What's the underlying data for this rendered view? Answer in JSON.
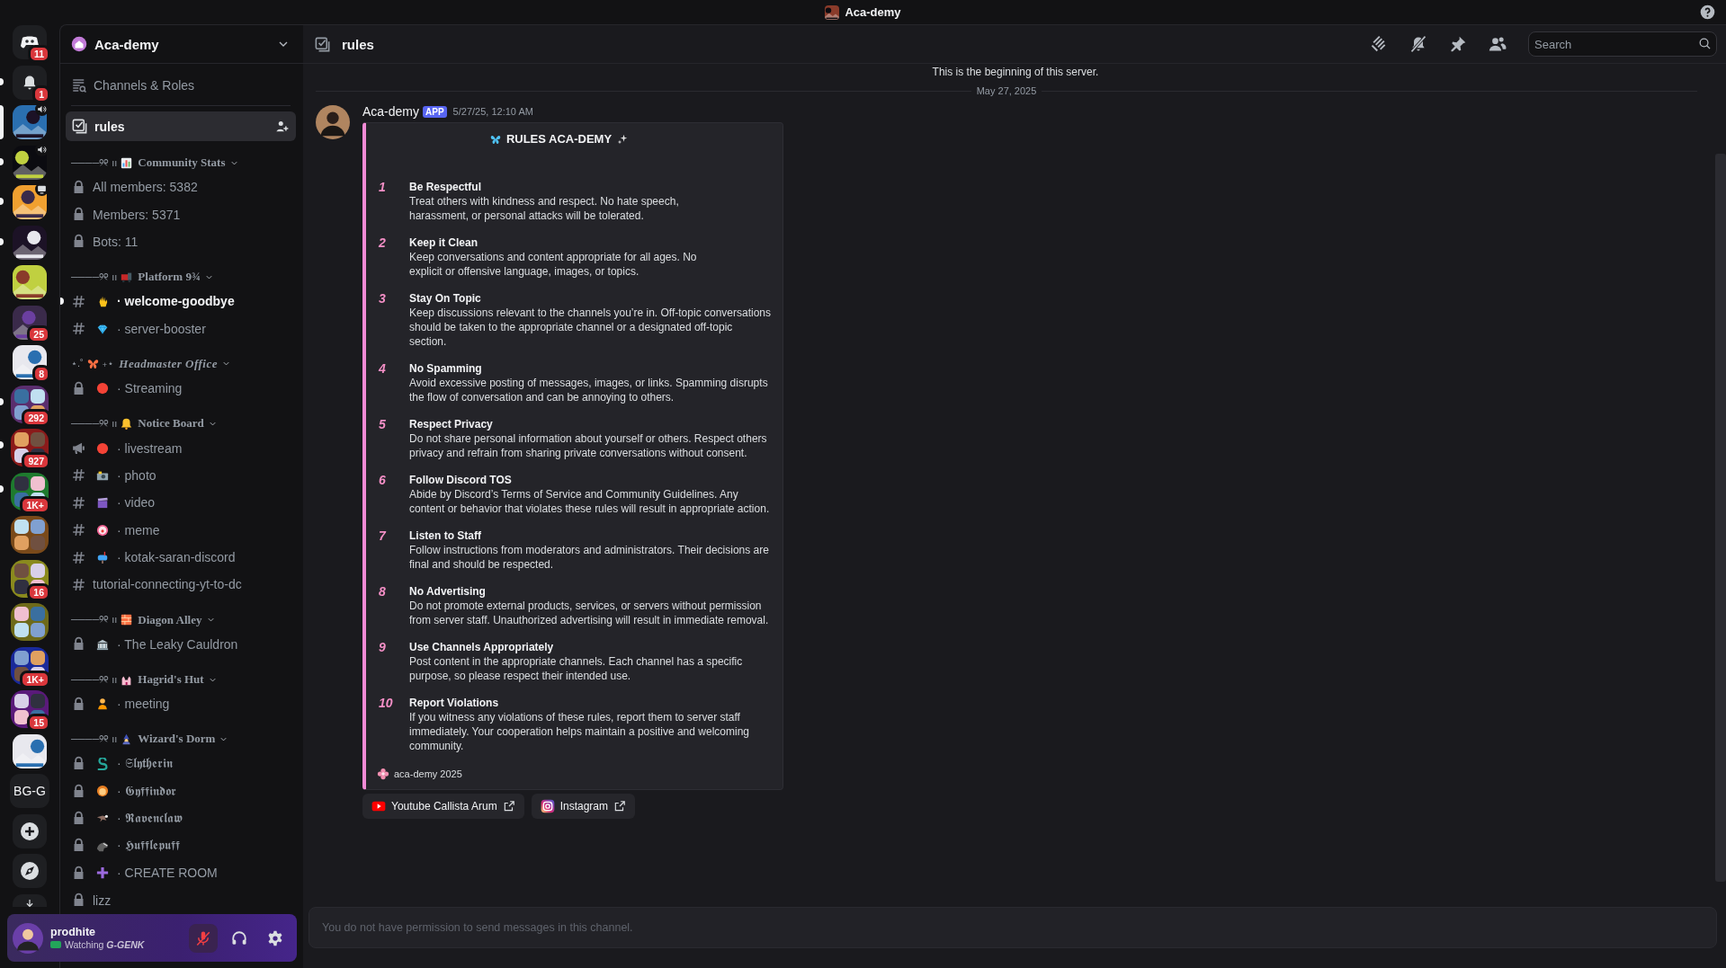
{
  "titlebar": {
    "title": "Aca-demy"
  },
  "servers": [
    {
      "kind": "home",
      "badge": "11",
      "selected": false,
      "unread": false
    },
    {
      "kind": "inbox",
      "badge": "1",
      "selected": false,
      "unread": true
    },
    {
      "kind": "picture",
      "selected": true,
      "unread": false
    },
    {
      "kind": "picture",
      "selected": false,
      "unread": true
    },
    {
      "kind": "picture",
      "selected": false,
      "unread": true
    },
    {
      "kind": "picture",
      "selected": false,
      "unread": true
    },
    {
      "kind": "picture",
      "selected": false,
      "unread": false
    },
    {
      "kind": "picture",
      "badge": "25",
      "selected": false,
      "unread": false
    },
    {
      "kind": "picture",
      "badge": "8",
      "selected": false,
      "unread": false
    },
    {
      "kind": "folder",
      "badge": "292",
      "selected": false,
      "unread": true
    },
    {
      "kind": "folder",
      "badge": "927",
      "selected": false,
      "unread": true
    },
    {
      "kind": "folder",
      "badge": "1K+",
      "selected": false,
      "unread": true
    },
    {
      "kind": "folder",
      "selected": false,
      "unread": false
    },
    {
      "kind": "folder",
      "badge": "16",
      "selected": false,
      "unread": false
    },
    {
      "kind": "folder",
      "selected": false,
      "unread": false
    },
    {
      "kind": "folder",
      "badge": "1K+",
      "selected": false,
      "unread": false
    },
    {
      "kind": "folder",
      "badge": "15",
      "selected": false,
      "unread": false
    },
    {
      "kind": "picture",
      "selected": false,
      "unread": false
    },
    {
      "kind": "text",
      "label": "BG-G",
      "selected": false,
      "unread": false
    },
    {
      "kind": "add",
      "selected": false,
      "unread": false
    },
    {
      "kind": "explore",
      "selected": false,
      "unread": false
    },
    {
      "kind": "download",
      "selected": false,
      "unread": false
    }
  ],
  "sidebar": {
    "server_name": "Aca-demy",
    "browse": "Channels & Roles",
    "top_channels": [
      {
        "kind": "rules",
        "name": "rules",
        "selected": true,
        "unread": false
      }
    ],
    "categories": [
      {
        "kind": "plain",
        "ornament": "────୨୧ ıı",
        "name": "Community Stats",
        "channels": [
          {
            "kind": "locked",
            "name": "All members: 5382",
            "selected": false,
            "unread": false
          },
          {
            "kind": "locked",
            "name": "Members: 5371",
            "selected": false,
            "unread": false
          },
          {
            "kind": "locked",
            "name": "Bots: 11",
            "selected": false,
            "unread": false
          }
        ]
      },
      {
        "kind": "plain",
        "ornament": "────୨୧ ıı",
        "name": "Platform 9¾",
        "channels": [
          {
            "kind": "text",
            "name": "· welcome-goodbye",
            "selected": false,
            "unread": true
          },
          {
            "kind": "text",
            "name": "· server-booster",
            "selected": false,
            "unread": false
          }
        ]
      },
      {
        "kind": "fancy",
        "ornament": "⋆.˚",
        "ornament_after": "₊⋆",
        "name": "Headmaster Office",
        "channels": [
          {
            "kind": "locked",
            "name": "·  Streaming",
            "selected": false,
            "unread": false
          }
        ]
      },
      {
        "kind": "plain",
        "ornament": "────୨୧ ıı",
        "name": "Notice Board",
        "channels": [
          {
            "kind": "announcement",
            "name": "· livestream",
            "selected": false,
            "unread": false
          },
          {
            "kind": "text",
            "name": "· photo",
            "selected": false,
            "unread": false
          },
          {
            "kind": "text",
            "name": "· video",
            "selected": false,
            "unread": false
          },
          {
            "kind": "text",
            "name": "· meme",
            "selected": false,
            "unread": false
          },
          {
            "kind": "text",
            "name": "· kotak-saran-discord",
            "selected": false,
            "unread": false
          },
          {
            "kind": "text",
            "name": "tutorial-connecting-yt-to-dc",
            "selected": false,
            "unread": false
          }
        ]
      },
      {
        "kind": "plain",
        "ornament": "────୨୧ ıı",
        "name": "Diagon Alley",
        "channels": [
          {
            "kind": "locked",
            "name": "· The Leaky Cauldron",
            "selected": false,
            "unread": false
          }
        ]
      },
      {
        "kind": "plain",
        "ornament": "────୨୧ ıı",
        "name": "Hagrid's Hut",
        "channels": [
          {
            "kind": "locked",
            "name": "· meeting",
            "selected": false,
            "unread": false
          }
        ]
      },
      {
        "kind": "plain",
        "ornament": "────୨୧ ıı",
        "name": "Wizard's Dorm",
        "channels": [
          {
            "kind": "locked",
            "name": "· 𝕾𝖑𝖞𝖙𝖍𝖊𝖗𝖎𝖓",
            "selected": false,
            "unread": false
          },
          {
            "kind": "locked",
            "name": "· 𝕲𝖞𝖋𝖋𝖎𝖓𝖉𝖔𝖗",
            "selected": false,
            "unread": false
          },
          {
            "kind": "locked",
            "name": "· 𝕽𝖆𝖛𝖊𝖓𝖈𝖑𝖆𝖜",
            "selected": false,
            "unread": false
          },
          {
            "kind": "locked",
            "name": "· 𝕳𝖚𝖋𝖋𝖑𝖊𝖕𝖚𝖋𝖋",
            "selected": false,
            "unread": false
          },
          {
            "kind": "locked",
            "name": "·  CREATE ROOM",
            "selected": false,
            "unread": false
          },
          {
            "kind": "locked",
            "name": "lizz",
            "selected": false,
            "unread": false
          }
        ]
      }
    ]
  },
  "channel_header": {
    "name": "rules",
    "search": {
      "placeholder": "Search"
    }
  },
  "chat": {
    "intro": "This is the beginning of this server.",
    "date_divider": "May 27, 2025",
    "message": {
      "author": "Aca-demy",
      "tag": "APP",
      "time": "5/27/25, 12:10 AM",
      "embed": {
        "title": "RULES ACA-DEMY",
        "rules": [
          {
            "number": "1",
            "title": "Be Respectful",
            "text": "Treat others with kindness and respect. No hate speech,\nharassment, or personal attacks will be tolerated."
          },
          {
            "number": "2",
            "title": "Keep it Clean",
            "text": "Keep conversations and content appropriate for all ages. No\nexplicit or offensive language, images, or topics."
          },
          {
            "number": "3",
            "title": "Stay On Topic",
            "text": "Keep discussions relevant to the channels you’re in. Off-topic conversations should be taken to the appropriate channel or a designated off-topic section."
          },
          {
            "number": "4",
            "title": "No Spamming",
            "text": "Avoid excessive posting of messages, images, or links. Spamming disrupts the flow of conversation and can be annoying to others."
          },
          {
            "number": "5",
            "title": "Respect Privacy",
            "text": "Do not share personal information about yourself or others. Respect others privacy and refrain from sharing private conversations without consent."
          },
          {
            "number": "6",
            "title": "Follow Discord TOS",
            "text": "Abide by Discord’s Terms of Service and Community Guidelines. Any content or behavior that violates these rules will result in appropriate action."
          },
          {
            "number": "7",
            "title": "Listen to Staff",
            "text": "Follow instructions from moderators and administrators. Their decisions are final and should be respected."
          },
          {
            "number": "8",
            "title": "No Advertising",
            "text": "Do not promote external products, services, or servers without permission from server staff. Unauthorized advertising will result in immediate removal."
          },
          {
            "number": "9",
            "title": "Use Channels Appropriately",
            "text": "Post content in the appropriate channels. Each channel has a specific purpose, so please respect their intended use."
          },
          {
            "number": "10",
            "title": "Report Violations",
            "text": "If you witness any violations of these rules, report them to server staff immediately. Your cooperation helps maintain a positive and welcoming community."
          }
        ],
        "footer": "aca-demy 2025"
      },
      "buttons": [
        {
          "kind": "youtube",
          "label": "Youtube Callista Arum"
        },
        {
          "kind": "instagram",
          "label": "Instagram"
        }
      ]
    }
  },
  "composer": {
    "placeholder": "You do not have permission to send messages in this channel.",
    "disabled": true
  },
  "user_panel": {
    "name": "prodhite",
    "status": "Watching **G-GENK**",
    "mic_muted": true
  }
}
